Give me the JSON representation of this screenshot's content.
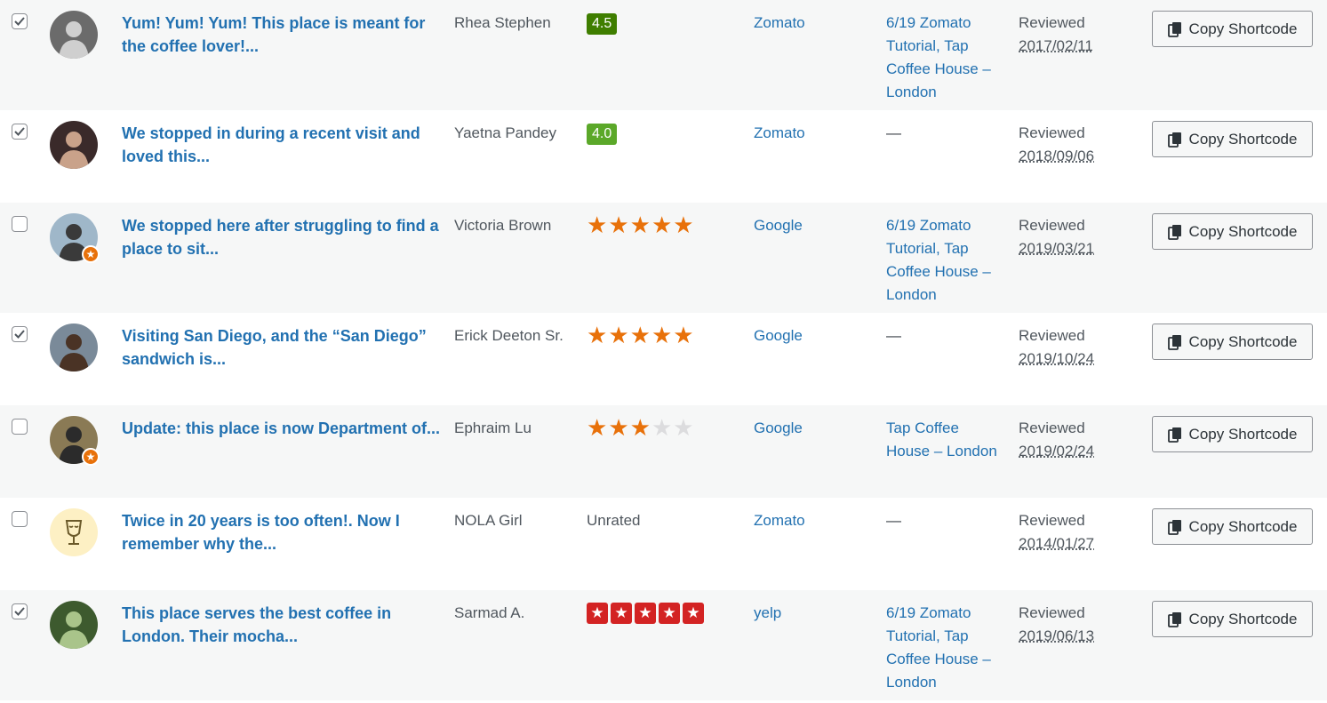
{
  "rows": [
    {
      "checked": true,
      "title": "Yum! Yum! Yum! This place is meant for the coffee lover!...",
      "author": "Rhea Stephen",
      "rating": {
        "kind": "pill",
        "text": "4.5",
        "color": "#3f7e00"
      },
      "platform": "Zomato",
      "assoc": "6/19 Zomato Tutorial, Tap Coffee House – London",
      "status": "Reviewed",
      "date": "2017/02/11",
      "avatar": {
        "bg": "#6b6b6b",
        "fg": "#cfcfcf",
        "badge": false
      }
    },
    {
      "checked": true,
      "title": "We stopped in during a recent visit and loved this...",
      "author": "Yaetna Pandey",
      "rating": {
        "kind": "pill",
        "text": "4.0",
        "color": "#5ba829"
      },
      "platform": "Zomato",
      "assoc": "—",
      "status": "Reviewed",
      "date": "2018/09/06",
      "avatar": {
        "bg": "#3a2a2a",
        "fg": "#c9a28a",
        "badge": false
      }
    },
    {
      "checked": false,
      "title": "We stopped here after struggling to find a place to sit...",
      "author": "Victoria Brown",
      "rating": {
        "kind": "stars",
        "value": 5
      },
      "platform": "Google",
      "assoc": "6/19 Zomato Tutorial, Tap Coffee House – London",
      "status": "Reviewed",
      "date": "2019/03/21",
      "avatar": {
        "bg": "#9fb7c9",
        "fg": "#3a3a3a",
        "badge": true
      }
    },
    {
      "checked": true,
      "title": "Visiting San Diego, and the “San Diego” sandwich is...",
      "author": "Erick Deeton Sr.",
      "rating": {
        "kind": "stars",
        "value": 5
      },
      "platform": "Google",
      "assoc": "—",
      "status": "Reviewed",
      "date": "2019/10/24",
      "avatar": {
        "bg": "#7a8a99",
        "fg": "#4a3325",
        "badge": false
      }
    },
    {
      "checked": false,
      "title": "Update: this place is now Department of...",
      "author": "Ephraim Lu",
      "rating": {
        "kind": "stars",
        "value": 3
      },
      "platform": "Google",
      "assoc": "Tap Coffee House – London",
      "status": "Reviewed",
      "date": "2019/02/24",
      "avatar": {
        "bg": "#8a7a55",
        "fg": "#2b2b2b",
        "badge": true
      }
    },
    {
      "checked": false,
      "title": "Twice in 20 years is too often!. Now I remember why the...",
      "author": "NOLA Girl",
      "rating": {
        "kind": "text",
        "text": "Unrated"
      },
      "platform": "Zomato",
      "assoc": "—",
      "status": "Reviewed",
      "date": "2014/01/27",
      "avatar": {
        "bg": "#fdf0c4",
        "fg": "#6b5a2a",
        "badge": false,
        "glass": true
      }
    },
    {
      "checked": true,
      "title": "This place serves the best coffee in London. Their mocha...",
      "author": "Sarmad A.",
      "rating": {
        "kind": "yelp",
        "value": 5
      },
      "platform": "yelp",
      "assoc": "6/19 Zomato Tutorial, Tap Coffee House – London",
      "status": "Reviewed",
      "date": "2019/06/13",
      "avatar": {
        "bg": "#3d5a2e",
        "fg": "#a9c48a",
        "badge": false
      }
    }
  ],
  "copy_label": "Copy Shortcode",
  "copy_icon": "copy-icon"
}
